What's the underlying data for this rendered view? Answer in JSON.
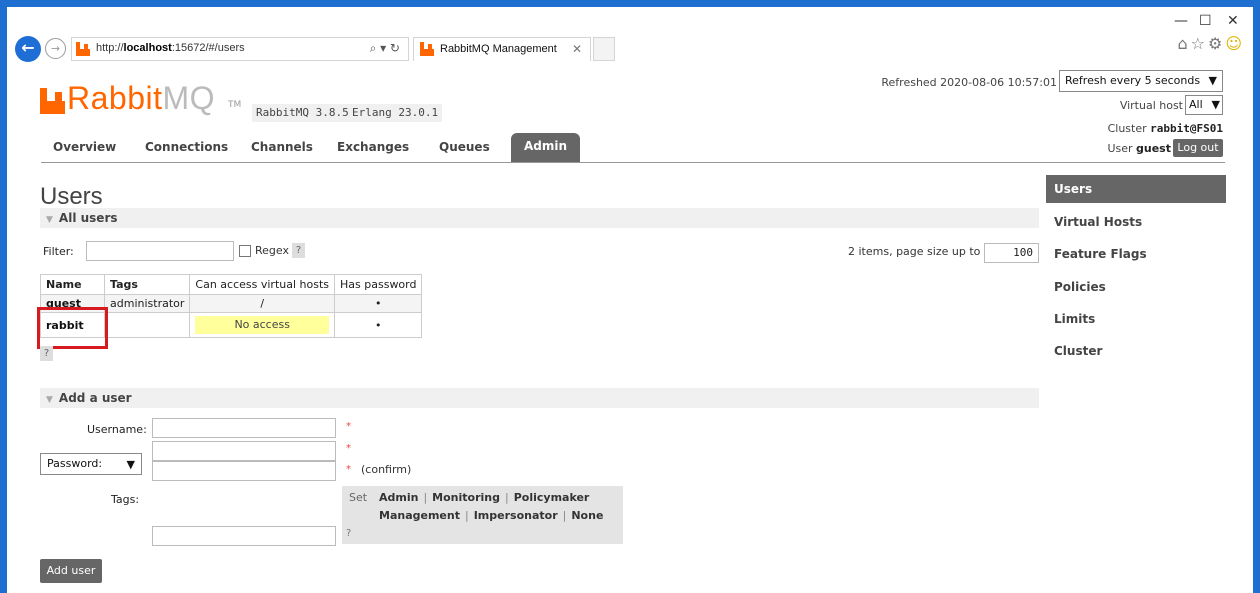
{
  "browser": {
    "url_prefix": "http://",
    "url_host": "localhost",
    "url_rest": ":15672/#/users",
    "tab_title": "RabbitMQ Management",
    "search_glyph": "⌕ ▾ ↻"
  },
  "header": {
    "logo_text": "Rabbit",
    "logo_mq": "MQ",
    "logo_tm": "TM",
    "version": "RabbitMQ 3.8.5",
    "erlang": "Erlang 23.0.1",
    "refreshed": "Refreshed 2020-08-06 10:57:01",
    "refresh_option": "Refresh every 5 seconds",
    "vhost_label": "Virtual host",
    "vhost_option": "All",
    "cluster_label": "Cluster",
    "cluster_name": "rabbit@FS01",
    "user_label": "User",
    "user_name": "guest",
    "logout": "Log out"
  },
  "nav": {
    "tabs": [
      "Overview",
      "Connections",
      "Channels",
      "Exchanges",
      "Queues",
      "Admin"
    ],
    "active": "Admin"
  },
  "page": {
    "title": "Users",
    "all_users_section": "All users",
    "filter_label": "Filter:",
    "regex_label": "Regex",
    "help": "?",
    "pager_text": "2 items, page size up to",
    "page_size": "100"
  },
  "users_table": {
    "columns": [
      "Name",
      "Tags",
      "Can access virtual hosts",
      "Has password"
    ],
    "rows": [
      {
        "name": "guest",
        "tags": "administrator",
        "vhosts": "/",
        "has_password": "•"
      },
      {
        "name": "rabbit",
        "tags": "",
        "vhosts": "No access",
        "has_password": "•"
      }
    ]
  },
  "add_user": {
    "section": "Add a user",
    "username_label": "Username:",
    "password_option": "Password:",
    "required": "*",
    "confirm": "(confirm)",
    "tags_label": "Tags:",
    "set_label": "Set",
    "tag_options_row1": [
      "Admin",
      "Monitoring",
      "Policymaker"
    ],
    "tag_options_row2": [
      "Management",
      "Impersonator",
      "None"
    ],
    "help": "?",
    "submit": "Add user"
  },
  "sidebar": {
    "items": [
      "Users",
      "Virtual Hosts",
      "Feature Flags",
      "Policies",
      "Limits",
      "Cluster"
    ],
    "active": "Users"
  },
  "colors": {
    "brand": "#ff6600",
    "highlight_box": "#d71920",
    "no_access_bg": "#ffff9c",
    "active_tab": "#666666"
  }
}
